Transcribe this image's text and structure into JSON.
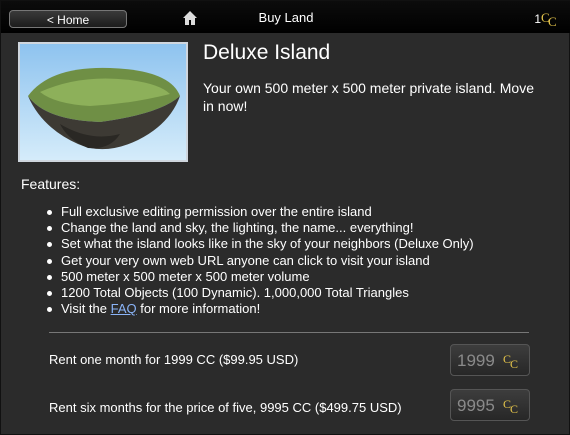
{
  "header": {
    "back_label": "< Home",
    "title": "Buy Land",
    "balance": "1",
    "home_icon": "home-icon",
    "currency_icon": "cc-icon"
  },
  "product": {
    "name": "Deluxe Island",
    "description": "Your own 500 meter x 500 meter private island. Move in now!",
    "image_icon": "island-image"
  },
  "features": {
    "label": "Features:",
    "items": [
      "Full exclusive editing permission over the entire island",
      "Change the land and sky, the lighting, the name... everything!",
      "Set what the island looks like in the sky of your neighbors (Deluxe Only)",
      "Get your very own web URL anyone can click to visit your island",
      "500 meter x 500 meter x 500 meter volume",
      "1200 Total Objects (100 Dynamic). 1,000,000 Total Triangles"
    ],
    "faq_prefix": "Visit the ",
    "faq_link": "FAQ",
    "faq_suffix": " for more information!"
  },
  "offers": [
    {
      "label": "Rent one month for 1999 CC ($99.95 USD)",
      "price": "1999"
    },
    {
      "label": "Rent six months for the price of five, 9995 CC ($499.75 USD)",
      "price": "9995"
    }
  ],
  "colors": {
    "panel_bg": "#2b2b2b",
    "topbar_bg": "#000000",
    "link": "#8ab4f8",
    "cc_gold": "#e4c44a"
  }
}
